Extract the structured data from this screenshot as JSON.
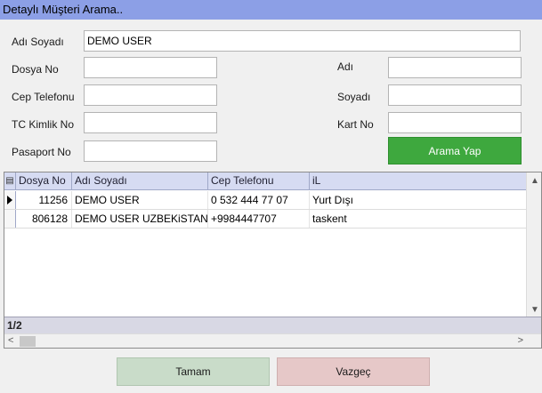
{
  "window": {
    "title": "Detaylı Müşteri Arama.."
  },
  "form": {
    "adi_soyadi": {
      "label": "Adı Soyadı",
      "value": "DEMO USER"
    },
    "dosya_no": {
      "label": "Dosya No",
      "value": ""
    },
    "adi": {
      "label": "Adı",
      "value": ""
    },
    "cep_telefonu": {
      "label": "Cep Telefonu",
      "value": ""
    },
    "soyadi": {
      "label": "Soyadı",
      "value": ""
    },
    "tc_kimlik_no": {
      "label": "TC Kimlik No",
      "value": ""
    },
    "kart_no": {
      "label": "Kart No",
      "value": ""
    },
    "pasaport_no": {
      "label": "Pasaport No",
      "value": ""
    },
    "search_button": "Arama Yap"
  },
  "grid": {
    "columns": [
      "Dosya No",
      "Adı Soyadı",
      "Cep Telefonu",
      "iL"
    ],
    "rows": [
      {
        "dosya_no": "11256",
        "adi_soyadi": "DEMO USER",
        "cep_telefonu": "0 532 444 77 07",
        "il": "Yurt Dışı"
      },
      {
        "dosya_no": "806128",
        "adi_soyadi": "DEMO USER UZBEKiSTAN",
        "cep_telefonu": "+9984447707",
        "il": "taskent"
      }
    ],
    "pager": "1/2"
  },
  "buttons": {
    "ok": "Tamam",
    "cancel": "Vazgeç"
  },
  "colors": {
    "titlebar": "#8c9fe6",
    "search_button": "#3ea83e",
    "grid_header": "#d6dbf2",
    "ok_button": "#c9dcc9",
    "cancel_button": "#e6c8c8"
  }
}
